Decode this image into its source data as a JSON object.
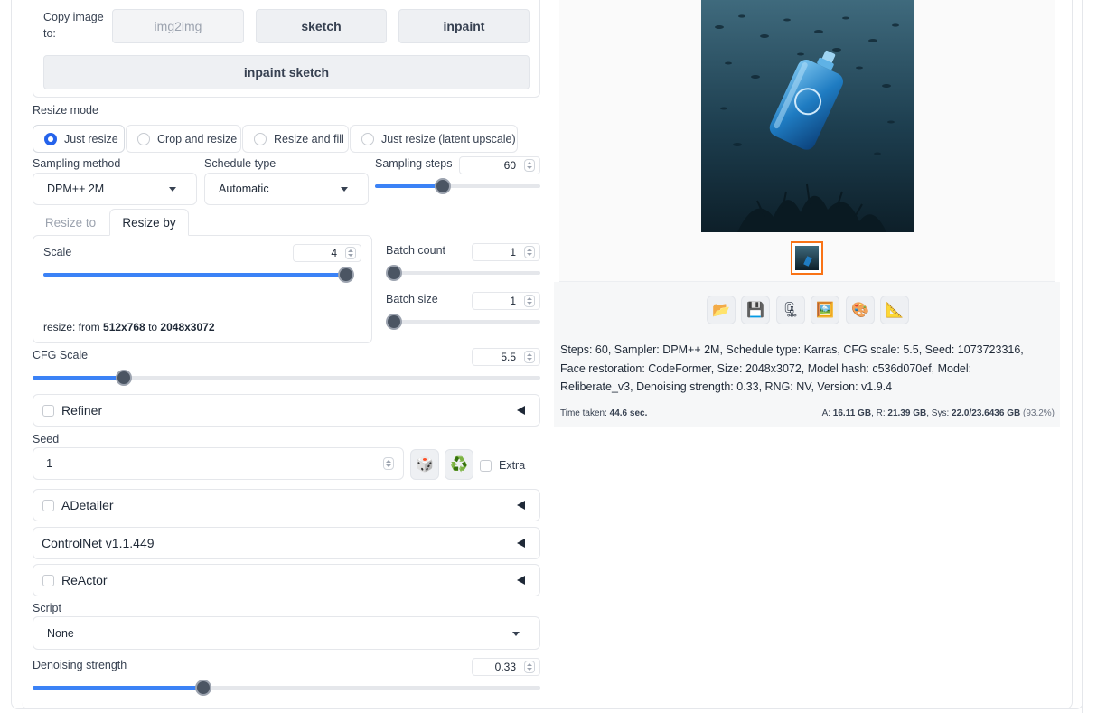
{
  "copy_image": {
    "label": "Copy image to:",
    "buttons": [
      "img2img",
      "sketch",
      "inpaint"
    ],
    "inpaint_sketch": "inpaint sketch"
  },
  "resize_mode": {
    "label": "Resize mode",
    "options": [
      "Just resize",
      "Crop and resize",
      "Resize and fill",
      "Just resize (latent upscale)"
    ],
    "selected": "Just resize"
  },
  "sampling": {
    "method_label": "Sampling method",
    "method_value": "DPM++ 2M",
    "schedule_label": "Schedule type",
    "schedule_value": "Automatic",
    "steps_label": "Sampling steps",
    "steps_value": "60",
    "steps_fraction": 0.4
  },
  "resize_tabs": [
    "Resize to",
    "Resize by"
  ],
  "scale": {
    "label": "Scale",
    "value": "4",
    "fraction": 1.0,
    "info_prefix": "resize: from ",
    "from": "512x768",
    "to_word": " to ",
    "to": "2048x3072"
  },
  "batch": {
    "count_label": "Batch count",
    "count_value": "1",
    "size_label": "Batch size",
    "size_value": "1"
  },
  "cfg": {
    "label": "CFG Scale",
    "value": "5.5",
    "fraction": 0.17
  },
  "accordions": {
    "refiner": "Refiner",
    "adetailer": "ADetailer",
    "controlnet": "ControlNet v1.1.449",
    "reactor": "ReActor"
  },
  "seed": {
    "label": "Seed",
    "value": "-1",
    "extra_label": "Extra"
  },
  "script": {
    "label": "Script",
    "value": "None"
  },
  "denoising": {
    "label": "Denoising strength",
    "value": "0.33",
    "fraction": 0.33
  },
  "icons": [
    "folder-icon",
    "save-icon",
    "zip-icon",
    "image-icon",
    "palette-icon",
    "ruler-icon"
  ],
  "generation_info": "Steps: 60, Sampler: DPM++ 2M, Schedule type: Karras, CFG scale: 5.5, Seed: 1073723316, Face restoration: CodeFormer, Size: 2048x3072, Model hash: c536d070ef, Model: Reliberate_v3, Denoising strength: 0.33, RNG: NV, Version: v1.9.4",
  "stats": {
    "time_label": "Time taken: ",
    "time_value": "44.6 sec.",
    "a_label": "A",
    "a_value": "16.11 GB",
    "r_label": "R",
    "r_value": "21.39 GB",
    "sys_label": "Sys",
    "sys_value": "22.0/23.6436 GB",
    "sys_pct": "(93.2%)"
  }
}
